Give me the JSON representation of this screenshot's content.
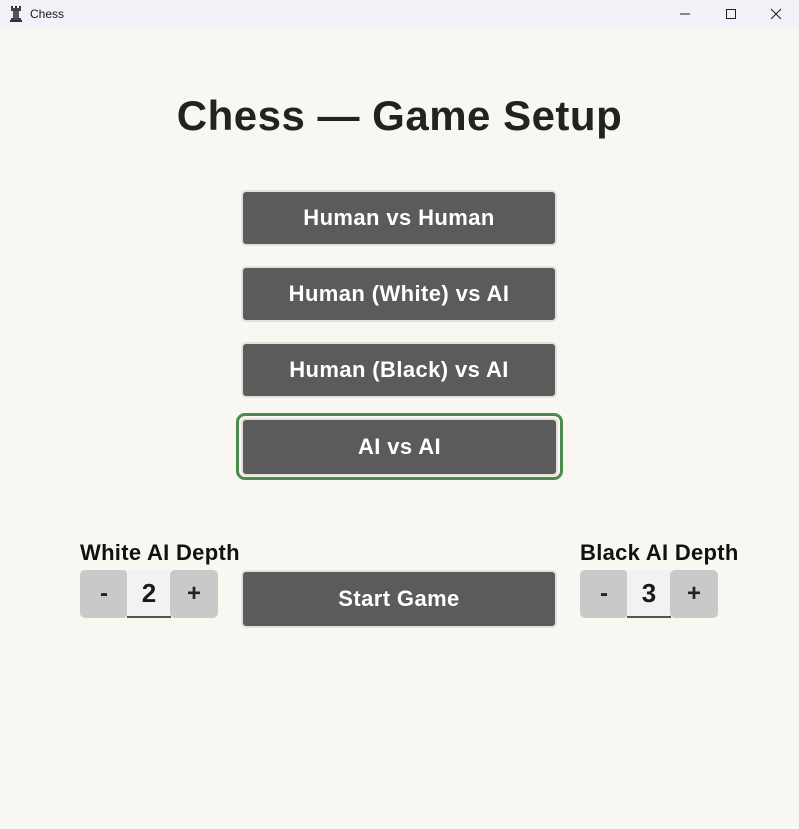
{
  "window": {
    "title": "Chess"
  },
  "heading": "Chess — Game Setup",
  "modes": [
    {
      "label": "Human vs Human",
      "selected": false
    },
    {
      "label": "Human (White) vs AI",
      "selected": false
    },
    {
      "label": "Human (Black) vs AI",
      "selected": false
    },
    {
      "label": "AI vs AI",
      "selected": true
    }
  ],
  "white_depth": {
    "label": "White AI Depth",
    "minus": "-",
    "value": "2",
    "plus": "+"
  },
  "black_depth": {
    "label": "Black AI Depth",
    "minus": "-",
    "value": "3",
    "plus": "+"
  },
  "start_button": "Start Game",
  "colors": {
    "background": "#f9f7f1",
    "button": "#5b5b5b",
    "selected_ring": "#4e8a4e",
    "stepper": "#c9c9c9"
  },
  "icons": {
    "app": "chess-rook-icon",
    "minimize": "minimize-icon",
    "maximize": "maximize-icon",
    "close": "close-icon"
  }
}
